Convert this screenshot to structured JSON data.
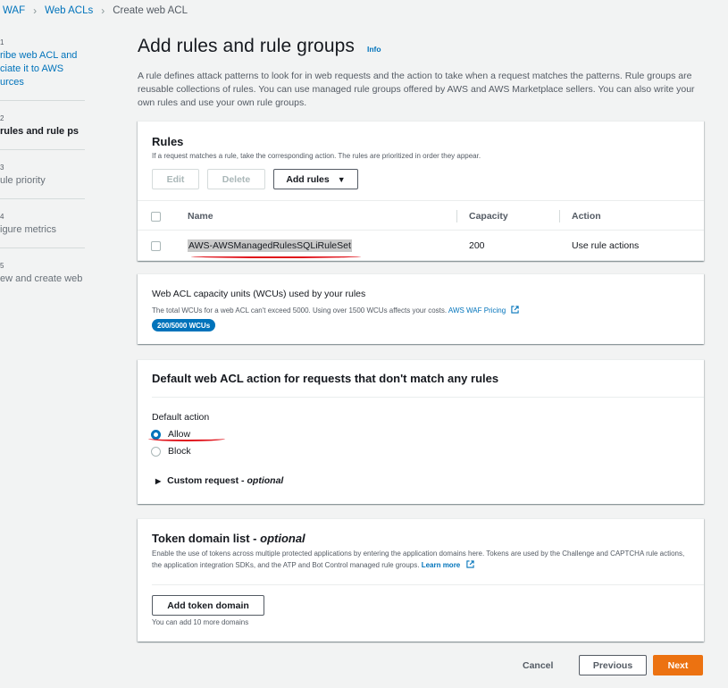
{
  "breadcrumb": {
    "items": [
      "WAF",
      "Web ACLs",
      "Create web ACL"
    ]
  },
  "steps": [
    {
      "num": "1",
      "label": "ribe web ACL and ciate it to AWS urces"
    },
    {
      "num": "2",
      "label": "rules and rule ps"
    },
    {
      "num": "3",
      "label": "ule priority"
    },
    {
      "num": "4",
      "label": "igure metrics"
    },
    {
      "num": "5",
      "label": "ew and create web"
    }
  ],
  "page": {
    "title": "Add rules and rule groups",
    "info": "Info",
    "description": "A rule defines attack patterns to look for in web requests and the action to take when a request matches the patterns. Rule groups are reusable collections of rules. You can use managed rule groups offered by AWS and AWS Marketplace sellers. You can also write your own rules and use your own rule groups."
  },
  "rules": {
    "title": "Rules",
    "subtitle": "If a request matches a rule, take the corresponding action. The rules are prioritized in order they appear.",
    "buttons": {
      "edit": "Edit",
      "delete": "Delete",
      "add": "Add rules"
    },
    "columns": {
      "name": "Name",
      "capacity": "Capacity",
      "action": "Action"
    },
    "rows": [
      {
        "name": "AWS-AWSManagedRulesSQLiRuleSet",
        "capacity": "200",
        "action": "Use rule actions"
      }
    ]
  },
  "wcu": {
    "title": "Web ACL capacity units (WCUs) used by your rules",
    "subtitle": "The total WCUs for a web ACL can't exceed 5000. Using over 1500 WCUs affects your costs.",
    "pricing_link": "AWS WAF Pricing",
    "badge": "200/5000 WCUs"
  },
  "default_action": {
    "title": "Default web ACL action for requests that don't match any rules",
    "label": "Default action",
    "options": [
      "Allow",
      "Block"
    ],
    "selected": "Allow",
    "custom_request": "Custom request -",
    "custom_optional": "optional"
  },
  "token": {
    "title": "Token domain list -",
    "title_optional": "optional",
    "description": "Enable the use of tokens across multiple protected applications by entering the application domains here. Tokens are used by the Challenge and CAPTCHA rule actions, the application integration SDKs, and the ATP and Bot Control managed rule groups.",
    "learn_more": "Learn more",
    "button": "Add token domain",
    "hint": "You can add 10 more domains"
  },
  "footer": {
    "cancel": "Cancel",
    "previous": "Previous",
    "next": "Next"
  },
  "colors": {
    "accent": "#0073bb",
    "primary_button": "#ec7211",
    "annotation": "#e0121a"
  }
}
